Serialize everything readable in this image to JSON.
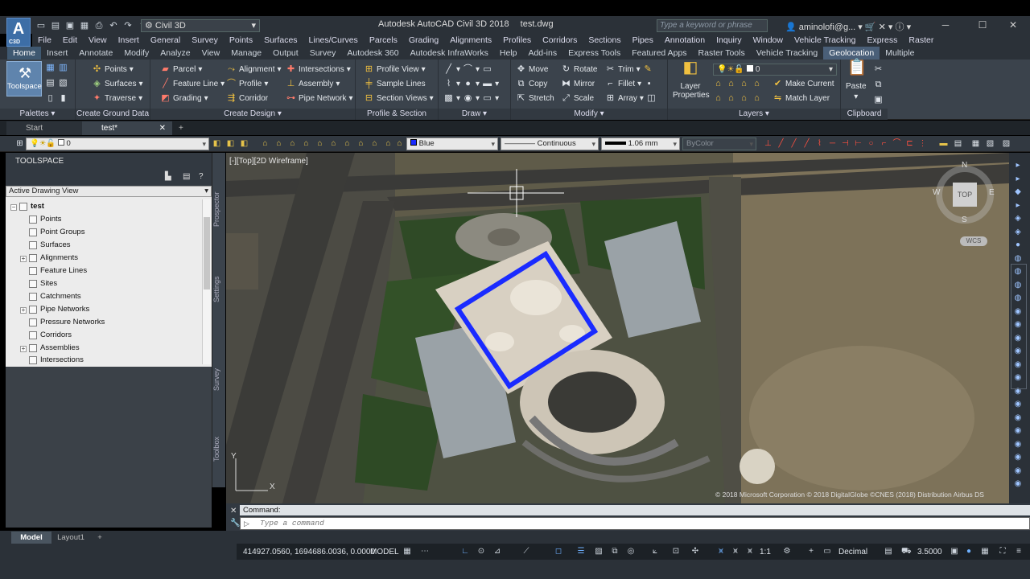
{
  "app": {
    "workspace": "Civil 3D",
    "title": "Autodesk AutoCAD Civil 3D 2018",
    "file": "test.dwg",
    "search_placeholder": "Type a keyword or phrase",
    "user": "aminolofi@g...",
    "app_button": "A",
    "app_button_sub": "C3D"
  },
  "menubar": [
    "File",
    "Edit",
    "View",
    "Insert",
    "General",
    "Survey",
    "Points",
    "Surfaces",
    "Lines/Curves",
    "Parcels",
    "Grading",
    "Alignments",
    "Profiles",
    "Corridors",
    "Sections",
    "Pipes",
    "Annotation",
    "Inquiry",
    "Window",
    "Vehicle Tracking",
    "Express",
    "Raster"
  ],
  "ribbon_tabs": [
    "Home",
    "Insert",
    "Annotate",
    "Modify",
    "Analyze",
    "View",
    "Manage",
    "Output",
    "Survey",
    "Autodesk 360",
    "Autodesk InfraWorks",
    "Help",
    "Add-ins",
    "Express Tools",
    "Featured Apps",
    "Raster Tools",
    "Vehicle Tracking",
    "Geolocation",
    "Multiple"
  ],
  "ribbon": {
    "palettes": {
      "title": "Palettes",
      "toolspace": "Toolspace"
    },
    "ground": {
      "title": "Create Ground Data",
      "points": "Points",
      "surfaces": "Surfaces",
      "traverse": "Traverse"
    },
    "design": {
      "title": "Create Design",
      "parcel": "Parcel",
      "feature_line": "Feature Line",
      "grading": "Grading",
      "alignment": "Alignment",
      "profile": "Profile",
      "corridor": "Corridor",
      "intersections": "Intersections",
      "assembly": "Assembly",
      "pipe_network": "Pipe Network"
    },
    "profile_section": {
      "title": "Profile & Section Views",
      "profile_view": "Profile View",
      "sample_lines": "Sample Lines",
      "section_views": "Section Views"
    },
    "draw": {
      "title": "Draw"
    },
    "modify": {
      "title": "Modify",
      "move": "Move",
      "copy": "Copy",
      "stretch": "Stretch",
      "rotate": "Rotate",
      "mirror": "Mirror",
      "scale": "Scale",
      "trim": "Trim",
      "fillet": "Fillet",
      "array": "Array"
    },
    "layers": {
      "title": "Layers",
      "layer_properties": "Layer Properties",
      "layer_value": "0",
      "make_current": "Make Current",
      "match_layer": "Match Layer"
    },
    "clipboard": {
      "title": "Clipboard",
      "paste": "Paste"
    }
  },
  "doc_tabs": [
    "Start",
    "test*"
  ],
  "properties": {
    "layer": "0",
    "color": "Blue",
    "linetype": "Continuous",
    "lineweight": "1.06 mm",
    "plotstyle": "ByColor"
  },
  "toolspace": {
    "title": "TOOLSPACE",
    "view": "Active Drawing View",
    "root": "test",
    "items": [
      "Points",
      "Point Groups",
      "Surfaces",
      "Alignments",
      "Feature Lines",
      "Sites",
      "Catchments",
      "Pipe Networks",
      "Pressure Networks",
      "Corridors",
      "Assemblies",
      "Intersections"
    ],
    "side_tabs": [
      "Prospector",
      "Settings",
      "Survey",
      "Toolbox"
    ]
  },
  "viewport": {
    "label": "[-][Top][2D Wireframe]",
    "compass": {
      "n": "N",
      "s": "S",
      "e": "E",
      "w": "W",
      "top": "TOP"
    },
    "wcs": "WCS",
    "copyright": "© 2018 Microsoft Corporation © 2018 DigitalGlobe ©CNES (2018) Distribution Airbus DS"
  },
  "command": {
    "history": "Command:",
    "placeholder": "Type a command"
  },
  "layout_tabs": [
    "Model",
    "Layout1"
  ],
  "status": {
    "coords": "414927.0560, 1694686.0036, 0.0000",
    "mode": "MODEL",
    "scale": "1:1",
    "units": "Decimal",
    "annoscale": "3.5000"
  },
  "colors": {
    "accent": "#3f5870",
    "selection": "#1a2bff",
    "ribbon_bg": "#3b434c"
  }
}
